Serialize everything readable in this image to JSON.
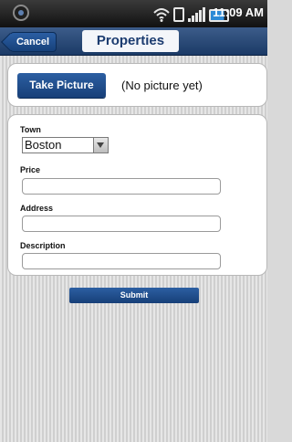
{
  "status_bar": {
    "time": "11:09 AM",
    "icons": [
      "notification-icon",
      "wifi-icon",
      "sync-icon",
      "signal-icon",
      "battery-icon"
    ]
  },
  "header": {
    "back_label": "Cancel",
    "title": "Properties"
  },
  "picture": {
    "button_label": "Take Picture",
    "status_text": "(No picture yet)"
  },
  "form": {
    "town": {
      "label": "Town",
      "value": "Boston"
    },
    "price": {
      "label": "Price",
      "value": ""
    },
    "address": {
      "label": "Address",
      "value": ""
    },
    "description": {
      "label": "Description",
      "value": ""
    }
  },
  "submit_label": "Submit",
  "colors": {
    "header_blue": "#1b3a66",
    "button_blue": "#173f78",
    "title_text": "#1c3c70"
  }
}
